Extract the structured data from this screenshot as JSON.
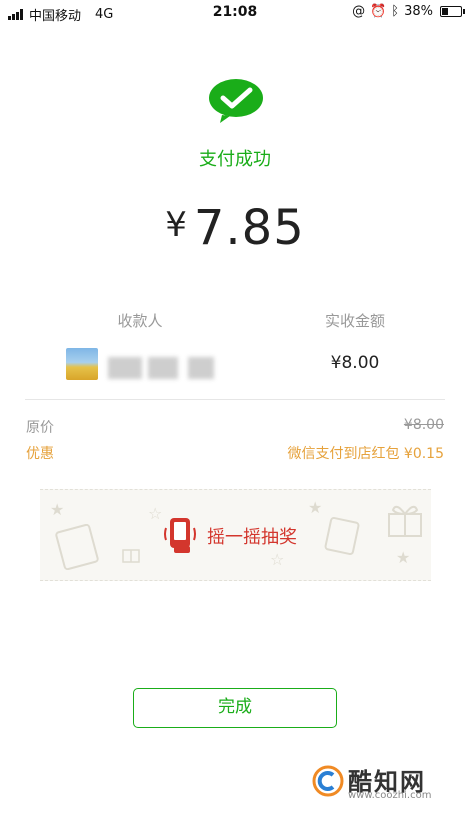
{
  "status_bar": {
    "carrier": "中国移动",
    "network": "4G",
    "time": "21:08",
    "battery": "38%",
    "battery_level": 0.38,
    "icons": [
      "signal-icon",
      "rotation-lock-icon",
      "alarm-icon",
      "bluetooth-icon",
      "battery-icon"
    ]
  },
  "result": {
    "status_text": "支付成功",
    "currency_symbol": "¥",
    "amount": "7.85",
    "icon": "wechat-pay-check-icon"
  },
  "details": {
    "payee_label": "收款人",
    "received_label": "实收金额",
    "received_amount": "¥8.00"
  },
  "pricing": {
    "original_label": "原价",
    "original_value": "¥8.00",
    "discount_label": "优惠",
    "discount_value": "微信支付到店红包 ¥0.15"
  },
  "banner": {
    "text": "摇一摇抽奖",
    "icon": "shake-hand-icon"
  },
  "actions": {
    "done_label": "完成"
  },
  "watermark": {
    "name": "酷知网",
    "url": "www.coozhi.com"
  },
  "colors": {
    "wechat_green": "#1aad19",
    "discount_orange": "#e6a23c",
    "banner_red": "#d3362d"
  }
}
